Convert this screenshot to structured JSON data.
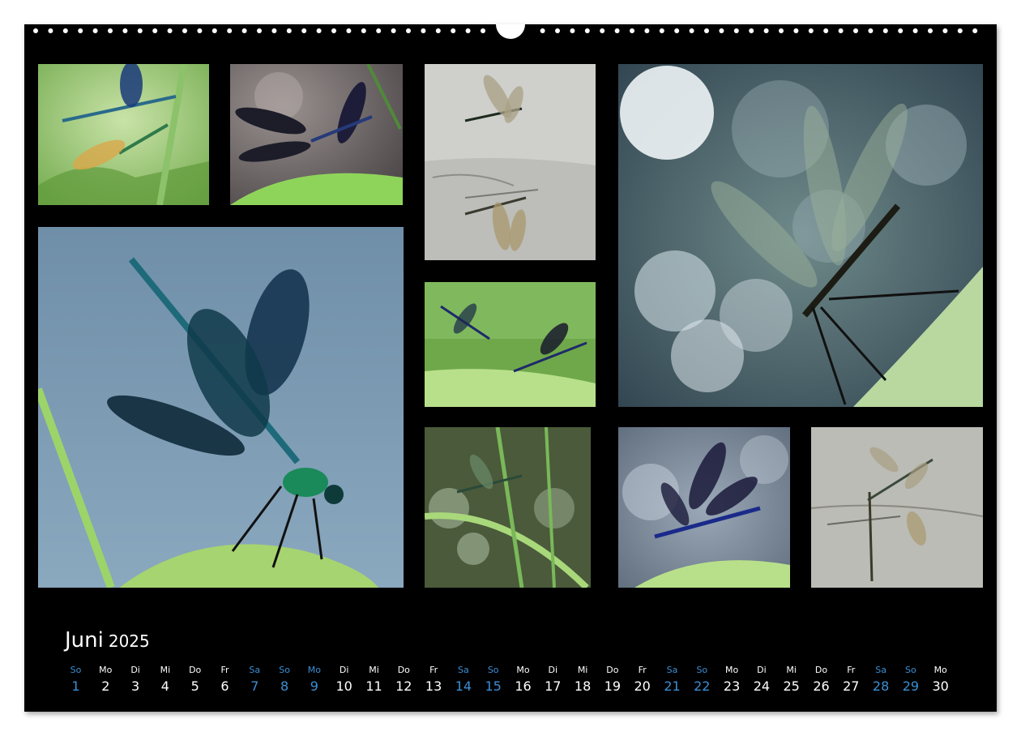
{
  "calendar": {
    "month": "Juni",
    "year": "2025",
    "accent_color": "#3a8fd6",
    "days": [
      {
        "name": "So",
        "date": "1",
        "highlight": true
      },
      {
        "name": "Mo",
        "date": "2",
        "highlight": false
      },
      {
        "name": "Di",
        "date": "3",
        "highlight": false
      },
      {
        "name": "Mi",
        "date": "4",
        "highlight": false
      },
      {
        "name": "Do",
        "date": "5",
        "highlight": false
      },
      {
        "name": "Fr",
        "date": "6",
        "highlight": false
      },
      {
        "name": "Sa",
        "date": "7",
        "highlight": true
      },
      {
        "name": "So",
        "date": "8",
        "highlight": true
      },
      {
        "name": "Mo",
        "date": "9",
        "highlight": true
      },
      {
        "name": "Di",
        "date": "10",
        "highlight": false
      },
      {
        "name": "Mi",
        "date": "11",
        "highlight": false
      },
      {
        "name": "Do",
        "date": "12",
        "highlight": false
      },
      {
        "name": "Fr",
        "date": "13",
        "highlight": false
      },
      {
        "name": "Sa",
        "date": "14",
        "highlight": true
      },
      {
        "name": "So",
        "date": "15",
        "highlight": true
      },
      {
        "name": "Mo",
        "date": "16",
        "highlight": false
      },
      {
        "name": "Di",
        "date": "17",
        "highlight": false
      },
      {
        "name": "Mi",
        "date": "18",
        "highlight": false
      },
      {
        "name": "Do",
        "date": "19",
        "highlight": false
      },
      {
        "name": "Fr",
        "date": "20",
        "highlight": false
      },
      {
        "name": "Sa",
        "date": "21",
        "highlight": true
      },
      {
        "name": "So",
        "date": "22",
        "highlight": true
      },
      {
        "name": "Mo",
        "date": "23",
        "highlight": false
      },
      {
        "name": "Di",
        "date": "24",
        "highlight": false
      },
      {
        "name": "Mi",
        "date": "25",
        "highlight": false
      },
      {
        "name": "Do",
        "date": "26",
        "highlight": false
      },
      {
        "name": "Fr",
        "date": "27",
        "highlight": false
      },
      {
        "name": "Sa",
        "date": "28",
        "highlight": true
      },
      {
        "name": "So",
        "date": "29",
        "highlight": true
      },
      {
        "name": "Mo",
        "date": "30",
        "highlight": false
      }
    ]
  },
  "photos": [
    {
      "subject": "two-damselflies-on-grass"
    },
    {
      "subject": "dark-winged-damselfly-on-leaf"
    },
    {
      "subject": "damselfly-over-water-with-reflection"
    },
    {
      "subject": "backlit-damselfly-with-bokeh"
    },
    {
      "subject": "banded-demoiselle-closeup"
    },
    {
      "subject": "two-damselflies-on-green-blade"
    },
    {
      "subject": "damselfly-among-reeds-bokeh"
    },
    {
      "subject": "blue-demoiselle-on-leaf"
    },
    {
      "subject": "damselfly-above-water-reflection"
    }
  ],
  "colors": {
    "page_background": "#000000",
    "frame_background": "#ffffff",
    "text": "#ffffff"
  }
}
